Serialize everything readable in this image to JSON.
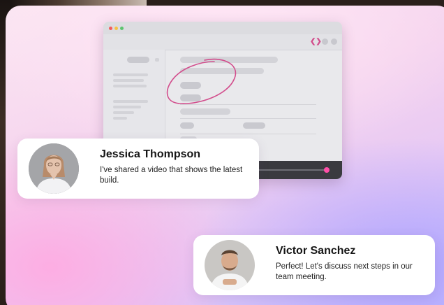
{
  "messages": [
    {
      "name": "Jessica Thompson",
      "text": "I've shared a video that shows the latest build.",
      "avatar_icon": "woman-avatar"
    },
    {
      "name": "Victor Sanchez",
      "text": "Perfect! Let's discuss next steps in our team meeting.",
      "avatar_icon": "man-avatar"
    }
  ],
  "colors": {
    "accent_pink": "#ff4fa8",
    "scribble_pink": "#d24d8c",
    "card_white": "#ffffff"
  }
}
